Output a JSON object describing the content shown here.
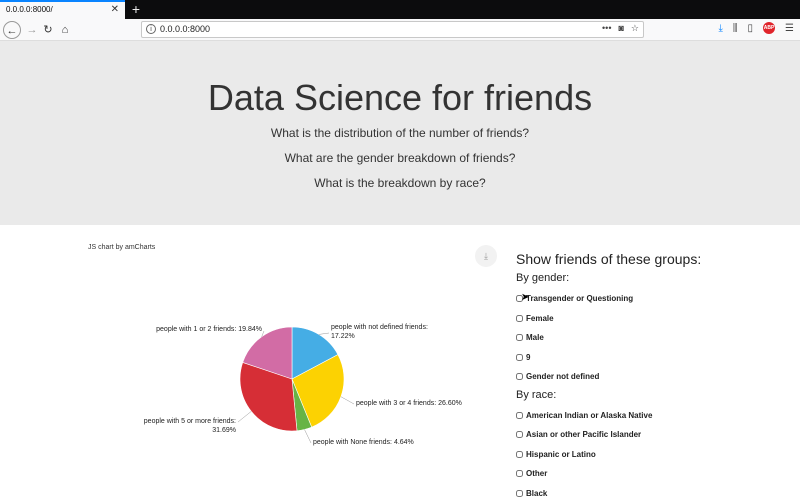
{
  "browser": {
    "tab_title": "0.0.0.0:8000/",
    "url": "0.0.0.0:8000",
    "close_glyph": "✕",
    "newtab_glyph": "+"
  },
  "hero": {
    "title": "Data Science for friends",
    "questions": [
      "What is the distribution of the number of friends?",
      "What are the gender breakdown of friends?",
      "What is the breakdown by race?"
    ]
  },
  "chart": {
    "credit": "JS chart by amCharts"
  },
  "chart_data": {
    "type": "pie",
    "slices": [
      {
        "label": "people with not defined friends: 17.22%",
        "value": 17.22,
        "color": "#45ade5"
      },
      {
        "label": "people with 3 or 4 friends: 26.60%",
        "value": 26.6,
        "color": "#fcd202"
      },
      {
        "label": "people with None friends: 4.64%",
        "value": 4.64,
        "color": "#67b445"
      },
      {
        "label": "people with 5 or more friends: 31.69%",
        "value": 31.69,
        "color": "#d62e36"
      },
      {
        "label": "people with 1 or 2 friends: 19.84%",
        "value": 19.84,
        "color": "#d26ca5"
      }
    ]
  },
  "filters": {
    "title": "Show friends of these groups:",
    "gender_heading": "By gender:",
    "gender": [
      "Transgender or Questioning",
      "Female",
      "Male",
      "9",
      "Gender not defined"
    ],
    "race_heading": "By race:",
    "race": [
      "American Indian or Alaska Native",
      "Asian or other Pacific Islander",
      "Hispanic or Latino",
      "Other",
      "Black"
    ]
  }
}
